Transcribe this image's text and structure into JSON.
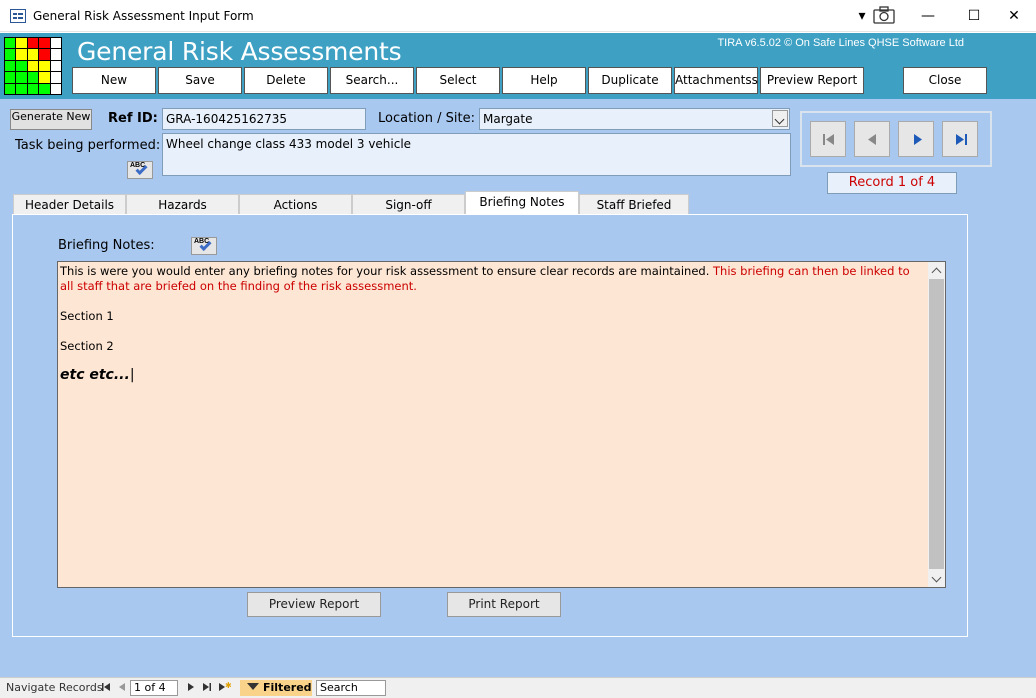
{
  "window": {
    "title": "General Risk Assessment Input Form"
  },
  "header": {
    "app_title": "General Risk Assessments",
    "version": "TIRA v6.5.02 © On Safe Lines QHSE Software Ltd",
    "buttons": [
      "New",
      "Save",
      "Delete",
      "Search...",
      "Select",
      "Help",
      "Duplicate",
      "Attachmentss",
      "Preview Report"
    ],
    "close_label": "Close",
    "logo_colors": [
      [
        "#00ff00",
        "#ffff00",
        "#ff0000",
        "#ff0000",
        "#ffffff"
      ],
      [
        "#00ff00",
        "#ffff00",
        "#ffff00",
        "#ff0000",
        "#ffffff"
      ],
      [
        "#00ff00",
        "#00ff00",
        "#ffff00",
        "#ffff00",
        "#ffffff"
      ],
      [
        "#00ff00",
        "#00ff00",
        "#00ff00",
        "#ffff00",
        "#ffffff"
      ],
      [
        "#00ff00",
        "#00ff00",
        "#00ff00",
        "#00ff00",
        "#ffffff"
      ]
    ]
  },
  "form": {
    "generate_new_label": "Generate New",
    "ref_id_label": "Ref ID:",
    "ref_id_value": "GRA-160425162735",
    "location_label": "Location / Site:",
    "location_value": "Margate",
    "task_label": "Task being performed:",
    "task_value": "Wheel change class 433 model 3 vehicle",
    "record_text": "Record 1 of 4"
  },
  "tabs": [
    {
      "label": "Header Details"
    },
    {
      "label": "Hazards"
    },
    {
      "label": "Actions"
    },
    {
      "label": "Sign-off"
    },
    {
      "label": "Briefing Notes"
    },
    {
      "label": "Staff Briefed"
    }
  ],
  "briefing": {
    "label": "Briefing Notes:",
    "text_black": "This is were you would enter any briefing notes for your risk assessment to ensure clear records are maintained.",
    "text_red": "This briefing can then be linked to all staff that are briefed on the finding of the risk assessment.",
    "section1": "Section 1",
    "section2": "Section 2",
    "etc": "etc etc..."
  },
  "bottom_buttons": {
    "preview": "Preview Report",
    "print": "Print Report"
  },
  "statusbar": {
    "navigate_label": "Navigate Records",
    "record_pos": "1 of 4",
    "filtered_label": "Filtered",
    "search_label": "Search"
  },
  "colors": {
    "form_bg": "#a9c8f0",
    "header_bg": "#3ea1c4",
    "notes_bg": "#fde6d4",
    "record_text": "#cc0000"
  }
}
